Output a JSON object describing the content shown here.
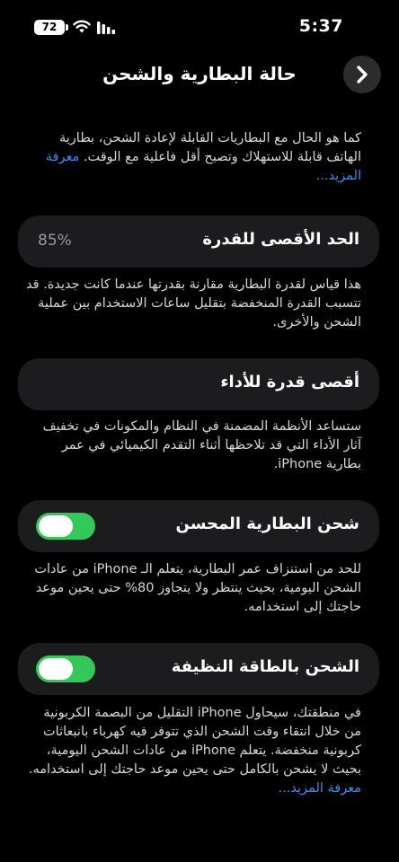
{
  "status_bar": {
    "battery_percent": "72",
    "time": "5:37",
    "icons": [
      "battery-icon",
      "wifi-icon",
      "cellular-signal-icon"
    ]
  },
  "header": {
    "title": "حالة البطارية والشحن",
    "back_icon": "chevron-right-icon"
  },
  "intro": {
    "text": "كما هو الحال مع البطاريات القابلة لإعادة الشحن، بطارية الهاتف قابلة للاستهلاك وتصبح أقل فاعلية مع الوقت. ",
    "link": "معرفة المزيد..."
  },
  "maximum_capacity": {
    "label": "الحد الأقصى للقدرة",
    "value": "85%",
    "description": "هذا قياس لقدرة البطارية مقارنة بقدرتها عندما كانت جديدة. قد تتسبب القدرة المنخفضة بتقليل ساعات الاستخدام بين عملية الشحن والأخرى."
  },
  "peak_performance": {
    "label": "أقصى قدرة للأداء",
    "description": "ستساعد الأنظمة المضمنة في النظام والمكونات في تخفيف آثار الأداء التي قد تلاحظها أثناء التقدم الكيميائي في عمر بطارية iPhone."
  },
  "optimized_charging": {
    "label": "شحن البطارية المحسن",
    "enabled": true,
    "description": "للحد من استنزاف عمر البطارية، يتعلم الـ iPhone من عادات الشحن اليومية، بحيث ينتظر ولا يتجاوز 80% حتى يحين موعد حاجتك إلى استخدامه."
  },
  "clean_energy_charging": {
    "label": "الشحن بالطاقة النظيفة",
    "enabled": true,
    "description": "في منطقتك، سيحاول iPhone التقليل من البصمة الكربونية من خلال انتقاء وقت الشحن الذي تتوفر فيه كهرباء بانبعاثات كربونية منخفضة. يتعلم iPhone من عادات الشحن اليومية، بحيث لا يشحن بالكامل حتى يحين موعد حاجتك إلى استخدامه. ",
    "link": "معرفة المزيد..."
  },
  "colors": {
    "background": "#000000",
    "card": "#1c1c1e",
    "toggle_on": "#34c759",
    "link": "#3a8ef6"
  }
}
